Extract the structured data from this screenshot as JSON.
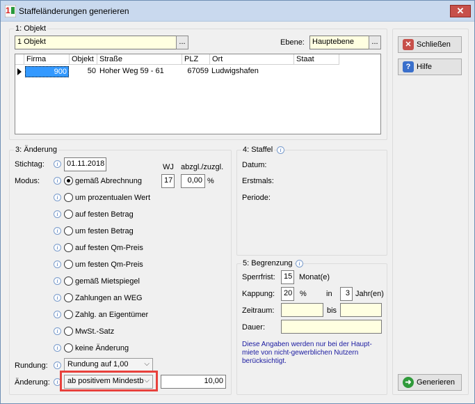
{
  "window": {
    "title": "Staffeländerungen generieren",
    "close": "✕"
  },
  "objekt": {
    "group": "1: Objekt",
    "value": "1 Objekt",
    "dots": "...",
    "ebene_label": "Ebene:",
    "ebene_value": "Hauptebene"
  },
  "table": {
    "columns": [
      "Firma",
      "Objekt",
      "Straße",
      "PLZ",
      "Ort",
      "Staat"
    ],
    "rows": [
      {
        "firma": "900",
        "objekt": "50",
        "strasse": "Hoher Weg 59 - 61",
        "plz": "67059",
        "ort": "Ludwigshafen",
        "staat": ""
      }
    ]
  },
  "aenderung": {
    "group": "3: Änderung",
    "stichtag_label": "Stichtag:",
    "stichtag": "01.11.2018",
    "wj_label": "WJ",
    "wj": "17",
    "abzgl_label": "abzgl./zuzgl.",
    "abzgl": "0,00",
    "pct": "%",
    "modus_label": "Modus:",
    "modes": [
      "gemäß Abrechnung",
      "um prozentualen Wert",
      "auf festen Betrag",
      "um festen Betrag",
      "auf festen Qm-Preis",
      "um festen Qm-Preis",
      "gemäß Mietspiegel",
      "Zahlungen an WEG",
      "Zahlg. an Eigentümer",
      "MwSt.-Satz",
      "keine Änderung"
    ],
    "rundung_label": "Rundung:",
    "rundung": "Rundung auf 1,00",
    "aenderung_label": "Änderung:",
    "aenderung_select": "ab positivem Mindestb",
    "aenderung_value": "10,00"
  },
  "staffel": {
    "group": "4: Staffel",
    "datum": "Datum:",
    "erstmals": "Erstmals:",
    "periode": "Periode:"
  },
  "begrenzung": {
    "group": "5: Begrenzung",
    "sperrfrist_label": "Sperrfrist:",
    "sperrfrist": "15",
    "monate": "Monat(e)",
    "kappung_label": "Kappung:",
    "kappung": "20",
    "pct": "%",
    "in": "in",
    "jahre_val": "3",
    "jahre": "Jahr(en)",
    "zeitraum_label": "Zeitraum:",
    "bis": "bis",
    "dauer_label": "Dauer:",
    "note": "Diese Angaben werden nur bei der Haupt-miete von nicht-gewerblichen Nutzern berücksichtigt."
  },
  "buttons": {
    "schliessen": "Schließen",
    "hilfe": "Hilfe",
    "generieren": "Generieren"
  },
  "colors": {
    "highlight_box": "#e8413c",
    "selected_cell": "#3399ff"
  }
}
